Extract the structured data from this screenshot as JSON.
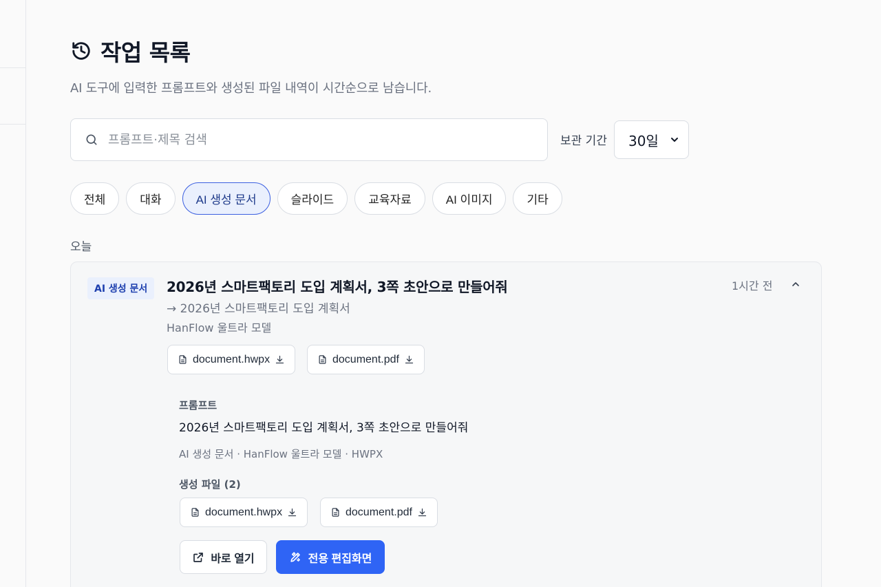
{
  "header": {
    "title": "작업 목록",
    "description": "AI 도구에 입력한 프롬프트와 생성된 파일 내역이 시간순으로 남습니다."
  },
  "search": {
    "placeholder": "프롬프트·제목 검색",
    "value": ""
  },
  "retention": {
    "label": "보관 기간",
    "selected": "30일"
  },
  "filters": [
    {
      "label": "전체",
      "active": false
    },
    {
      "label": "대화",
      "active": false
    },
    {
      "label": "AI 생성 문서",
      "active": true
    },
    {
      "label": "슬라이드",
      "active": false
    },
    {
      "label": "교육자료",
      "active": false
    },
    {
      "label": "AI 이미지",
      "active": false
    },
    {
      "label": "기타",
      "active": false
    }
  ],
  "group": {
    "label": "오늘"
  },
  "item": {
    "type_badge": "AI 생성 문서",
    "title": "2026년 스마트팩토리 도입 계획서, 3쪽 초안으로 만들어줘",
    "target": "→ 2026년 스마트팩토리 도입 계획서",
    "model": "HanFlow 울트라 모델",
    "time": "1시간 전",
    "files": [
      {
        "name": "document.hwpx"
      },
      {
        "name": "document.pdf"
      }
    ],
    "detail": {
      "prompt_label": "프롬프트",
      "prompt_text": "2026년 스마트팩토리 도입 계획서, 3쪽 초안으로 만들어줘",
      "meta": "AI 생성 문서 · HanFlow 울트라 모델 · HWPX",
      "files_label": "생성 파일 (2)",
      "files": [
        {
          "name": "document.hwpx"
        },
        {
          "name": "document.pdf"
        }
      ],
      "open_label": "바로 열기",
      "editor_label": "전용 편집화면"
    }
  },
  "colors": {
    "accent": "#2f64f5",
    "badge_bg": "#eaf0fd",
    "badge_text": "#1e40af"
  },
  "icons": {
    "title": "history-icon",
    "search": "search-icon",
    "select": "chevron-down-icon",
    "collapse": "chevron-up-icon",
    "file": "file-icon",
    "download": "download-icon",
    "open": "external-link-icon",
    "editor": "edit-tools-icon"
  }
}
